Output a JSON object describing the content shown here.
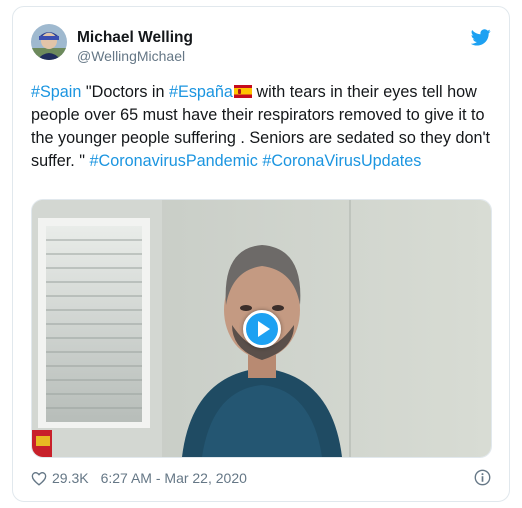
{
  "user": {
    "name": "Michael Welling",
    "handle": "@WellingMichael"
  },
  "tweet": {
    "segments": [
      {
        "text": "#Spain",
        "type": "hashtag"
      },
      {
        "text": " \"Doctors in ",
        "type": "text"
      },
      {
        "text": "#España",
        "type": "hashtag"
      },
      {
        "text": " with tears in their eyes tell how people over 65 must have their respirators removed to give it to the younger people suffering . Seniors are sedated so they don't suffer. \" ",
        "type": "text"
      },
      {
        "text": "#CoronavirusPandemic",
        "type": "hashtag"
      },
      {
        "text": " ",
        "type": "text"
      },
      {
        "text": "#CoronaVirusUpdates",
        "type": "hashtag"
      }
    ]
  },
  "footer": {
    "likes": "29.3K",
    "timestamp": "6:27 AM - Mar 22, 2020"
  },
  "icons": {
    "bird": "twitter-bird-icon",
    "heart": "heart-icon",
    "info": "info-icon",
    "play": "play-icon",
    "flag": "spain-flag-emoji"
  },
  "colors": {
    "link": "#1b95e0",
    "brand": "#1da1f2",
    "muted": "#657786",
    "border": "#e1e8ed"
  }
}
